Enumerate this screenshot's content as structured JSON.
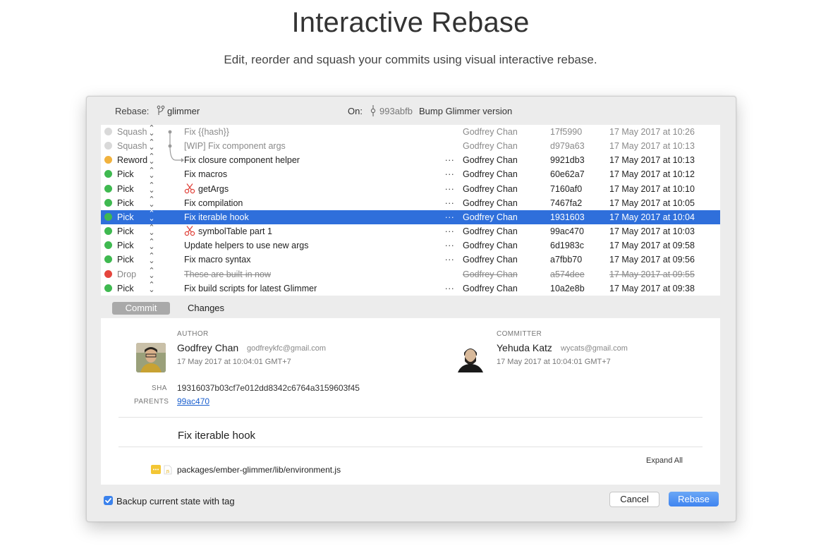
{
  "hero": {
    "title": "Interactive Rebase",
    "subtitle": "Edit, reorder and squash your commits using visual interactive rebase."
  },
  "topbar": {
    "rebase_label": "Rebase:",
    "branch": "glimmer",
    "on_label": "On:",
    "on_hash": "993abfb",
    "on_message": "Bump Glimmer version"
  },
  "commits": [
    {
      "action": "Squash",
      "message": "Fix {{hash}}",
      "author": "Godfrey Chan",
      "hash": "17f5990",
      "date": "17 May 2017 at 10:26",
      "status_color": "#d9d9d9"
    },
    {
      "action": "Squash",
      "message": "[WIP] Fix component args",
      "author": "Godfrey Chan",
      "hash": "d979a63",
      "date": "17 May 2017 at 10:13",
      "status_color": "#d9d9d9"
    },
    {
      "action": "Reword",
      "message": "Fix closure component helper",
      "author": "Godfrey Chan",
      "hash": "9921db3",
      "date": "17 May 2017 at 10:13",
      "ellipsis": "...",
      "status_color": "#f1b23e"
    },
    {
      "action": "Pick",
      "message": "Fix macros",
      "author": "Godfrey Chan",
      "hash": "60e62a7",
      "date": "17 May 2017 at 10:12",
      "ellipsis": "...",
      "status_color": "#3fb950"
    },
    {
      "action": "Pick",
      "message": "getArgs",
      "author": "Godfrey Chan",
      "hash": "7160af0",
      "date": "17 May 2017 at 10:10",
      "ellipsis": "...",
      "status_color": "#3fb950"
    },
    {
      "action": "Pick",
      "message": "Fix compilation",
      "author": "Godfrey Chan",
      "hash": "7467fa2",
      "date": "17 May 2017 at 10:05",
      "ellipsis": "...",
      "status_color": "#3fb950"
    },
    {
      "action": "Pick",
      "message": "Fix iterable hook",
      "author": "Godfrey Chan",
      "hash": "1931603",
      "date": "17 May 2017 at 10:04",
      "ellipsis": "...",
      "status_color": "#3fb950"
    },
    {
      "action": "Pick",
      "message": "symbolTable part 1",
      "author": "Godfrey Chan",
      "hash": "99ac470",
      "date": "17 May 2017 at 10:03",
      "ellipsis": "...",
      "status_color": "#3fb950"
    },
    {
      "action": "Pick",
      "message": "Update helpers to use new args",
      "author": "Godfrey Chan",
      "hash": "6d1983c",
      "date": "17 May 2017 at 09:58",
      "ellipsis": "...",
      "status_color": "#3fb950"
    },
    {
      "action": "Pick",
      "message": "Fix macro syntax",
      "author": "Godfrey Chan",
      "hash": "a7fbb70",
      "date": "17 May 2017 at 09:56",
      "ellipsis": "...",
      "status_color": "#3fb950"
    },
    {
      "action": "Drop",
      "message": "These are built-in now",
      "author": "Godfrey Chan",
      "hash": "a574dee",
      "date": "17 May 2017 at 09:55",
      "status_color": "#e5453d"
    },
    {
      "action": "Pick",
      "message": "Fix build scripts for latest Glimmer",
      "author": "Godfrey Chan",
      "hash": "10a2e8b",
      "date": "17 May 2017 at 09:38",
      "ellipsis": "...",
      "status_color": "#3fb950"
    }
  ],
  "tabs": {
    "commit": "Commit",
    "changes": "Changes"
  },
  "detail": {
    "author_label": "AUTHOR",
    "author_name": "Godfrey Chan",
    "author_email": "godfreykfc@gmail.com",
    "author_date": "17 May 2017 at 10:04:01 GMT+7",
    "committer_label": "COMMITTER",
    "committer_name": "Yehuda Katz",
    "committer_email": "wycats@gmail.com",
    "committer_date": "17 May 2017 at 10:04:01 GMT+7",
    "sha_label": "SHA",
    "sha": "19316037b03cf7e012dd8342c6764a3159603f45",
    "parents_label": "PARENTS",
    "parent": "99ac470",
    "subject": "Fix iterable hook",
    "expand_all": "Expand All",
    "file_type": "JS",
    "file_path": "packages/ember-glimmer/lib/environment.js"
  },
  "footer": {
    "backup_label": "Backup current state with tag",
    "backup_checked": true,
    "cancel": "Cancel",
    "rebase": "Rebase"
  },
  "colors": {
    "selection": "#2f6fdb",
    "accent": "#3f84f0",
    "link": "#1a5fcf"
  }
}
